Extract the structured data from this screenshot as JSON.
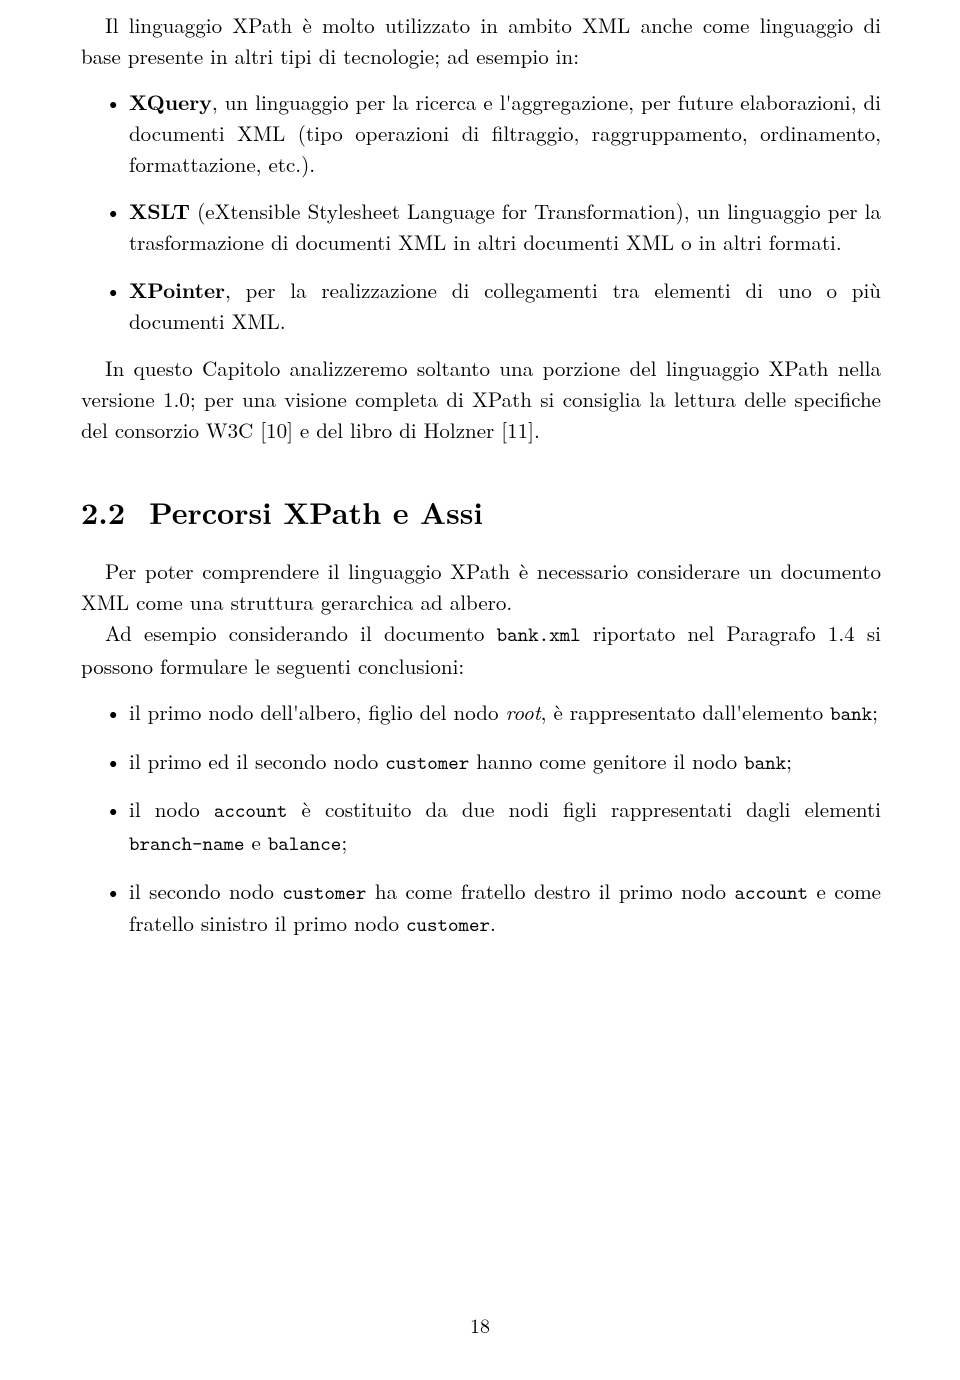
{
  "intro": "Il linguaggio XPath è molto utilizzato in ambito XML anche come linguaggio di base presente in altri tipi di tecnologie; ad esempio in:",
  "list1": {
    "item1_a": "XQuery",
    "item1_b": ", un linguaggio per la ricerca e l'aggregazione, per future elaborazioni, di documenti XML (tipo operazioni di filtraggio, raggruppamento, ordinamento, formattazione, etc.).",
    "item2_a": "XSLT",
    "item2_b": " (eXtensible Stylesheet Language for Transformation), un linguaggio per la trasformazione di documenti XML in altri documenti XML o in altri formati.",
    "item3_a": "XPointer",
    "item3_b": ", per la realizzazione di collegamenti tra elementi di uno o più documenti XML."
  },
  "para2": "In questo Capitolo analizzeremo soltanto una porzione del linguaggio XPath nella versione 1.0; per una visione completa di XPath si consiglia la lettura delle specifiche del consorzio W3C [10] e del libro di Holzner [11].",
  "section": {
    "number": "2.2",
    "title": "Percorsi XPath e Assi"
  },
  "para3_a": "Per poter comprendere il linguaggio XPath è necessario considerare un documento XML come una struttura gerarchica ad albero.",
  "para3_b1": "Ad esempio considerando il documento ",
  "para3_b2": "bank.xml",
  "para3_b3": " riportato nel Paragrafo 1.4 si possono formulare le seguenti conclusioni:",
  "list2": {
    "i1_a": "il primo nodo dell'albero, figlio del nodo ",
    "i1_b": "root",
    "i1_c": ", è rappresentato dall'elemento ",
    "i1_d": "bank",
    "i1_e": ";",
    "i2_a": "il primo ed il secondo nodo ",
    "i2_b": "customer",
    "i2_c": " hanno come genitore il nodo ",
    "i2_d": "bank",
    "i2_e": ";",
    "i3_a": "il nodo ",
    "i3_b": "account",
    "i3_c": " è costituito da due nodi figli rappresentati dagli elementi ",
    "i3_d": "branch-name",
    "i3_e": " e ",
    "i3_f": "balance",
    "i3_g": ";",
    "i4_a": "il secondo nodo ",
    "i4_b": "customer",
    "i4_c": " ha come fratello destro il primo nodo ",
    "i4_d": "account",
    "i4_e": " e come fratello sinistro il primo nodo ",
    "i4_f": "customer",
    "i4_g": "."
  },
  "pagenum": "18"
}
